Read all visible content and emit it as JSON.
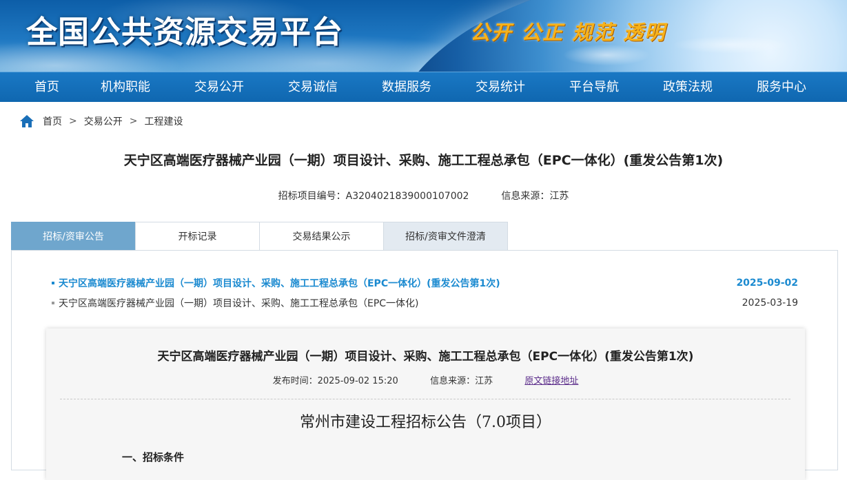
{
  "banner": {
    "title": "全国公共资源交易平台",
    "slogan": "公开 公正 规范 透明"
  },
  "nav": {
    "items": [
      "首页",
      "机构职能",
      "交易公开",
      "交易诚信",
      "数据服务",
      "交易统计",
      "平台导航",
      "政策法规",
      "服务中心"
    ]
  },
  "breadcrumb": {
    "items": [
      "首页",
      "交易公开",
      "工程建设"
    ],
    "separator": ">"
  },
  "project": {
    "title": "天宁区高端医疗器械产业园（一期）项目设计、采购、施工工程总承包（EPC一体化）(重发公告第1次)",
    "code_label": "招标项目编号：",
    "code": "A3204021839000107002",
    "source_label": "信息来源：",
    "source": "江苏"
  },
  "tabs": [
    {
      "label": "招标/资审公告",
      "state": "active"
    },
    {
      "label": "开标记录",
      "state": "normal"
    },
    {
      "label": "交易结果公示",
      "state": "normal"
    },
    {
      "label": "招标/资审文件澄清",
      "state": "gray"
    }
  ],
  "announcements": [
    {
      "title": "天宁区高端医疗器械产业园（一期）项目设计、采购、施工工程总承包（EPC一体化）(重发公告第1次)",
      "date": "2025-09-02",
      "active": true
    },
    {
      "title": "天宁区高端医疗器械产业园（一期）项目设计、采购、施工工程总承包（EPC一体化)",
      "date": "2025-03-19",
      "active": false
    }
  ],
  "document": {
    "title": "天宁区高端医疗器械产业园（一期）项目设计、采购、施工工程总承包（EPC一体化）(重发公告第1次)",
    "publish_label": "发布时间：",
    "publish_time": "2025-09-02 15:20",
    "source_label": "信息来源：",
    "source": "江苏",
    "link_label": "原文链接地址",
    "heading": "常州市建设工程招标公告（7.0项目）",
    "section": "一、招标条件"
  },
  "colors": {
    "nav_bg": "#0f67b0",
    "tab_active": "#6fa6cd",
    "link_active": "#1b8ad0",
    "slogan": "#f7b21a"
  }
}
